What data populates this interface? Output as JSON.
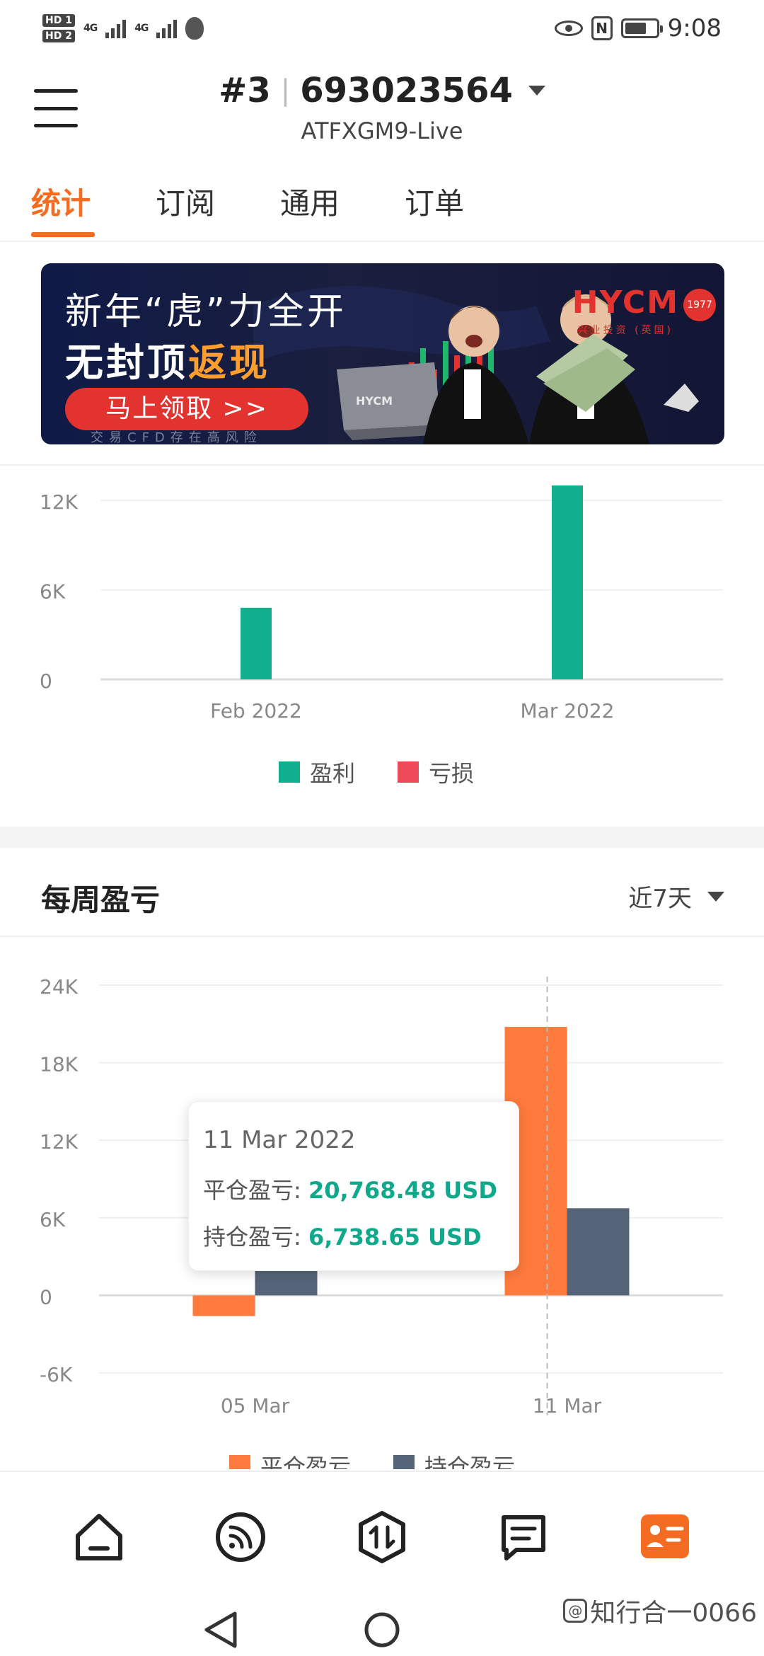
{
  "status_bar": {
    "hd1": "HD 1",
    "hd2": "HD 2",
    "net1": "4G",
    "net2": "4G",
    "time": "9:08",
    "nfc": "N"
  },
  "header": {
    "account_index": "#3",
    "account_number": "693023564",
    "server": "ATFXGM9-Live"
  },
  "tabs": [
    {
      "label": "统计",
      "active": true
    },
    {
      "label": "订阅",
      "active": false
    },
    {
      "label": "通用",
      "active": false
    },
    {
      "label": "订单",
      "active": false
    }
  ],
  "banner": {
    "line1": "新年“虎”力全开",
    "line2_prefix": "无封顶",
    "line2_highlight": "返现",
    "cta": "马上领取 >>",
    "risk": "交易CFD存在高风险",
    "logo": "HYCM",
    "logo_sub": "兴业投资 (英国)",
    "seal": "1977",
    "laptop_logo": "HYCM"
  },
  "chart_monthly": {
    "type": "bar",
    "categories": [
      "Feb 2022",
      "Mar 2022"
    ],
    "y_ticks": [
      "12K",
      "6K",
      "0"
    ],
    "ylim": [
      0,
      13000
    ],
    "series": [
      {
        "name": "盈利",
        "color": "#10b08f",
        "values": [
          4800,
          13000
        ]
      },
      {
        "name": "亏损",
        "color": "#ef4a5a",
        "values": [
          0,
          0
        ]
      }
    ],
    "legend": "bottom-center"
  },
  "weekly": {
    "title": "每周盈亏",
    "range_label": "近7天"
  },
  "chart_data": {
    "type": "bar",
    "categories": [
      "05 Mar",
      "11 Mar"
    ],
    "y_ticks": [
      "24K",
      "18K",
      "12K",
      "6K",
      "0",
      "-6K"
    ],
    "ylim": [
      -6000,
      24000
    ],
    "series": [
      {
        "name": "平仓盈亏",
        "color": "#ff7a3d",
        "values": [
          -1600,
          20768.48
        ]
      },
      {
        "name": "持仓盈亏",
        "color": "#566479",
        "values": [
          1900,
          6738.65
        ]
      }
    ],
    "legend": "bottom-center",
    "tooltip": {
      "date": "11 Mar 2022",
      "rows": [
        {
          "label": "平仓盈亏:",
          "value": "20,768.48 USD"
        },
        {
          "label": "持仓盈亏:",
          "value": "6,738.65 USD"
        }
      ]
    }
  },
  "bottom_nav": [
    {
      "icon": "home-icon"
    },
    {
      "icon": "signal-feed-icon"
    },
    {
      "icon": "trade-icon"
    },
    {
      "icon": "news-icon"
    },
    {
      "icon": "account-icon",
      "active": true
    }
  ],
  "watermark": "知行合一0066",
  "colors": {
    "accent": "#f36c21",
    "profit": "#10b08f",
    "loss": "#ef4a5a",
    "closed": "#ff7a3d",
    "open": "#566479"
  }
}
